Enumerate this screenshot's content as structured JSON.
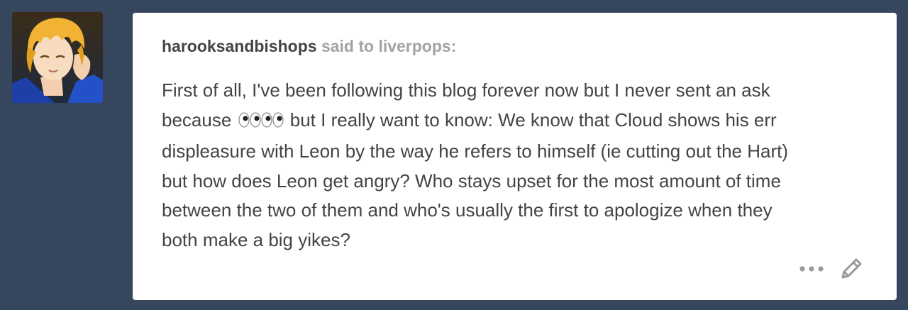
{
  "post": {
    "asker": "harooksandbishops",
    "said_to": "said to liverpops:",
    "question_lines": [
      {
        "before": "First of all, I've been following this blog forever now but I never sent an ask"
      },
      {
        "before": "because ",
        "emoji": "eyes",
        "after": " but I really want to know: We know that Cloud shows his err"
      },
      {
        "before": "displeasure with Leon by the way he refers to himself (ie cutting out the Hart)"
      },
      {
        "before": "but how does Leon get angry? Who stays upset for the most amount of time"
      },
      {
        "before": "between the two of them and who's usually the first to apologize when they"
      },
      {
        "before": "both make a big yikes?"
      }
    ]
  },
  "actions": {
    "more_icon": "more-dots-icon",
    "edit_icon": "pencil-icon"
  },
  "colors": {
    "background": "#36465d",
    "card": "#ffffff",
    "text": "#444444",
    "muted": "#a3a3a3",
    "icon": "#9a9a9a"
  }
}
